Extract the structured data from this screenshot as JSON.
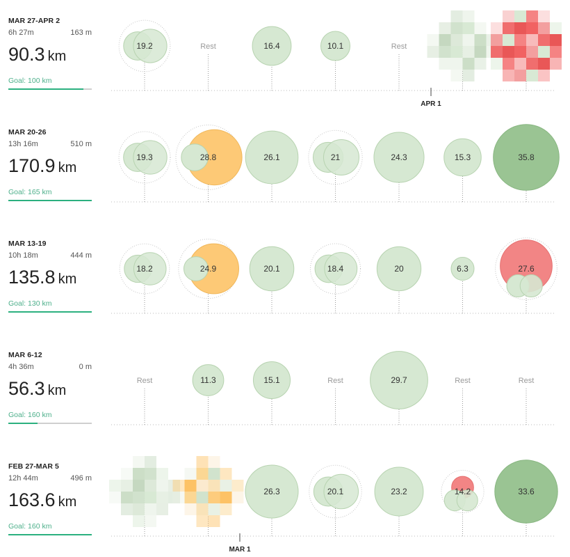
{
  "colors": {
    "easy": "#d6e8d2",
    "easy_stroke": "#b7d3b0",
    "long": "#9ac493",
    "tempo": "#fdc976",
    "race": "#f28585",
    "goal_fill": "#2bb07f",
    "goal_track": "#cfcfcf",
    "goal_text": "#4caf8a"
  },
  "weeks": [
    {
      "range": "MAR 27-APR 2",
      "time": "6h 27m",
      "elevation": "163 m",
      "distance": "90.3",
      "unit": "km",
      "goal_label": "Goal: 100 km",
      "goal_progress": 0.903,
      "month_marker": "APR 1",
      "days": [
        {
          "label": "19.2",
          "value": 19.2,
          "kind": "double",
          "color": "easy"
        },
        {
          "label": "Rest",
          "value": 0,
          "kind": "rest"
        },
        {
          "label": "16.4",
          "value": 16.4,
          "kind": "single",
          "color": "easy"
        },
        {
          "label": "10.1",
          "value": 10.1,
          "kind": "single",
          "color": "easy"
        },
        {
          "label": "Rest",
          "value": 0,
          "kind": "rest"
        },
        {
          "label": "",
          "value": 0,
          "kind": "pixelated",
          "color": "easy"
        },
        {
          "label": "",
          "value": 0,
          "kind": "pixelated",
          "color": "race"
        }
      ]
    },
    {
      "range": "MAR 20-26",
      "time": "13h 16m",
      "elevation": "510 m",
      "distance": "170.9",
      "unit": "km",
      "goal_label": "Goal: 165 km",
      "goal_progress": 1,
      "month_marker": "",
      "days": [
        {
          "label": "19.3",
          "value": 19.3,
          "kind": "double",
          "color": "easy"
        },
        {
          "label": "28.8",
          "value": 28.8,
          "kind": "double",
          "color": "tempo"
        },
        {
          "label": "26.1",
          "value": 26.1,
          "kind": "single",
          "color": "easy"
        },
        {
          "label": "21",
          "value": 21,
          "kind": "double",
          "color": "easy"
        },
        {
          "label": "24.3",
          "value": 24.3,
          "kind": "single",
          "color": "easy"
        },
        {
          "label": "15.3",
          "value": 15.3,
          "kind": "single",
          "color": "easy"
        },
        {
          "label": "35.8",
          "value": 35.8,
          "kind": "single",
          "color": "long"
        }
      ]
    },
    {
      "range": "MAR 13-19",
      "time": "10h 18m",
      "elevation": "444 m",
      "distance": "135.8",
      "unit": "km",
      "goal_label": "Goal: 130 km",
      "goal_progress": 1,
      "month_marker": "",
      "days": [
        {
          "label": "18.2",
          "value": 18.2,
          "kind": "double",
          "color": "easy"
        },
        {
          "label": "24.9",
          "value": 24.9,
          "kind": "double",
          "color": "tempo"
        },
        {
          "label": "20.1",
          "value": 20.1,
          "kind": "single",
          "color": "easy"
        },
        {
          "label": "18.4",
          "value": 18.4,
          "kind": "double",
          "color": "easy"
        },
        {
          "label": "20",
          "value": 20,
          "kind": "single",
          "color": "easy"
        },
        {
          "label": "6.3",
          "value": 6.3,
          "kind": "single",
          "color": "easy"
        },
        {
          "label": "27.6",
          "value": 27.6,
          "kind": "race",
          "color": "race"
        }
      ]
    },
    {
      "range": "MAR 6-12",
      "time": "4h 36m",
      "elevation": "0 m",
      "distance": "56.3",
      "unit": "km",
      "goal_label": "Goal: 160 km",
      "goal_progress": 0.352,
      "month_marker": "",
      "days": [
        {
          "label": "Rest",
          "value": 0,
          "kind": "rest"
        },
        {
          "label": "11.3",
          "value": 11.3,
          "kind": "single",
          "color": "easy"
        },
        {
          "label": "15.1",
          "value": 15.1,
          "kind": "single",
          "color": "easy"
        },
        {
          "label": "Rest",
          "value": 0,
          "kind": "rest"
        },
        {
          "label": "29.7",
          "value": 29.7,
          "kind": "single",
          "color": "easy"
        },
        {
          "label": "Rest",
          "value": 0,
          "kind": "rest"
        },
        {
          "label": "Rest",
          "value": 0,
          "kind": "rest"
        }
      ]
    },
    {
      "range": "FEB 27-MAR 5",
      "time": "12h 44m",
      "elevation": "496 m",
      "distance": "163.6",
      "unit": "km",
      "goal_label": "Goal: 160 km",
      "goal_progress": 1,
      "month_marker": "MAR 1",
      "days": [
        {
          "label": "",
          "value": 0,
          "kind": "pixelated",
          "color": "easy"
        },
        {
          "label": "",
          "value": 0,
          "kind": "pixelated",
          "color": "tempo"
        },
        {
          "label": "26.3",
          "value": 26.3,
          "kind": "single",
          "color": "easy"
        },
        {
          "label": "20.1",
          "value": 20.1,
          "kind": "double",
          "color": "easy"
        },
        {
          "label": "23.2",
          "value": 23.2,
          "kind": "single",
          "color": "easy"
        },
        {
          "label": "14.2",
          "value": 14.2,
          "kind": "race",
          "color": "race"
        },
        {
          "label": "33.6",
          "value": 33.6,
          "kind": "single",
          "color": "long"
        }
      ]
    }
  ]
}
